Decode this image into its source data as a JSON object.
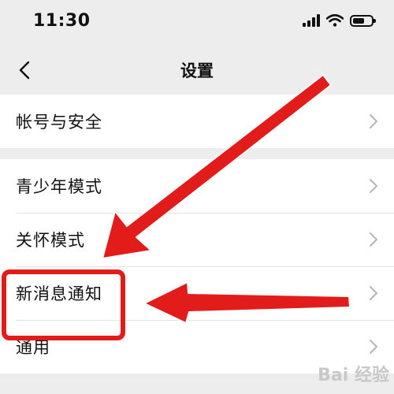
{
  "status_bar": {
    "time": "11:30"
  },
  "nav": {
    "title": "设置"
  },
  "groups": [
    {
      "items": [
        {
          "label": "帐号与安全"
        }
      ]
    },
    {
      "items": [
        {
          "label": "青少年模式"
        },
        {
          "label": "关怀模式"
        },
        {
          "label": "新消息通知"
        },
        {
          "label": "通用"
        }
      ]
    }
  ],
  "annotations": {
    "highlighted_item": "新消息通知",
    "highlight_color": "#e21b1b"
  },
  "watermark": "Bai 经验",
  "colors": {
    "background": "#ededed",
    "card": "#ffffff",
    "chevron": "#b5b5b5",
    "annotation_red": "#e21b1b"
  },
  "icons": {
    "back": "chevron-left-icon",
    "row": "chevron-right-icon",
    "signal": "signal-icon",
    "wifi": "wifi-icon",
    "battery": "battery-icon"
  }
}
